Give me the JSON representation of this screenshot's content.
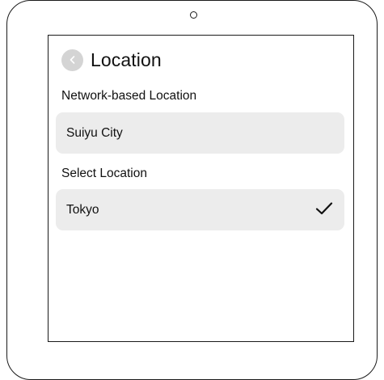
{
  "header": {
    "title": "Location",
    "back_icon": "chevron-left-icon"
  },
  "network_section": {
    "label": "Network-based Location",
    "value": "Suiyu City"
  },
  "select_section": {
    "label": "Select Location",
    "options": [
      {
        "label": "Tokyo",
        "selected": true,
        "icon": "checkmark-icon"
      }
    ]
  },
  "colors": {
    "frame": "#1a1a1a",
    "row_background": "#ececec",
    "back_button": "#d4d4d4",
    "text": "#111111"
  }
}
